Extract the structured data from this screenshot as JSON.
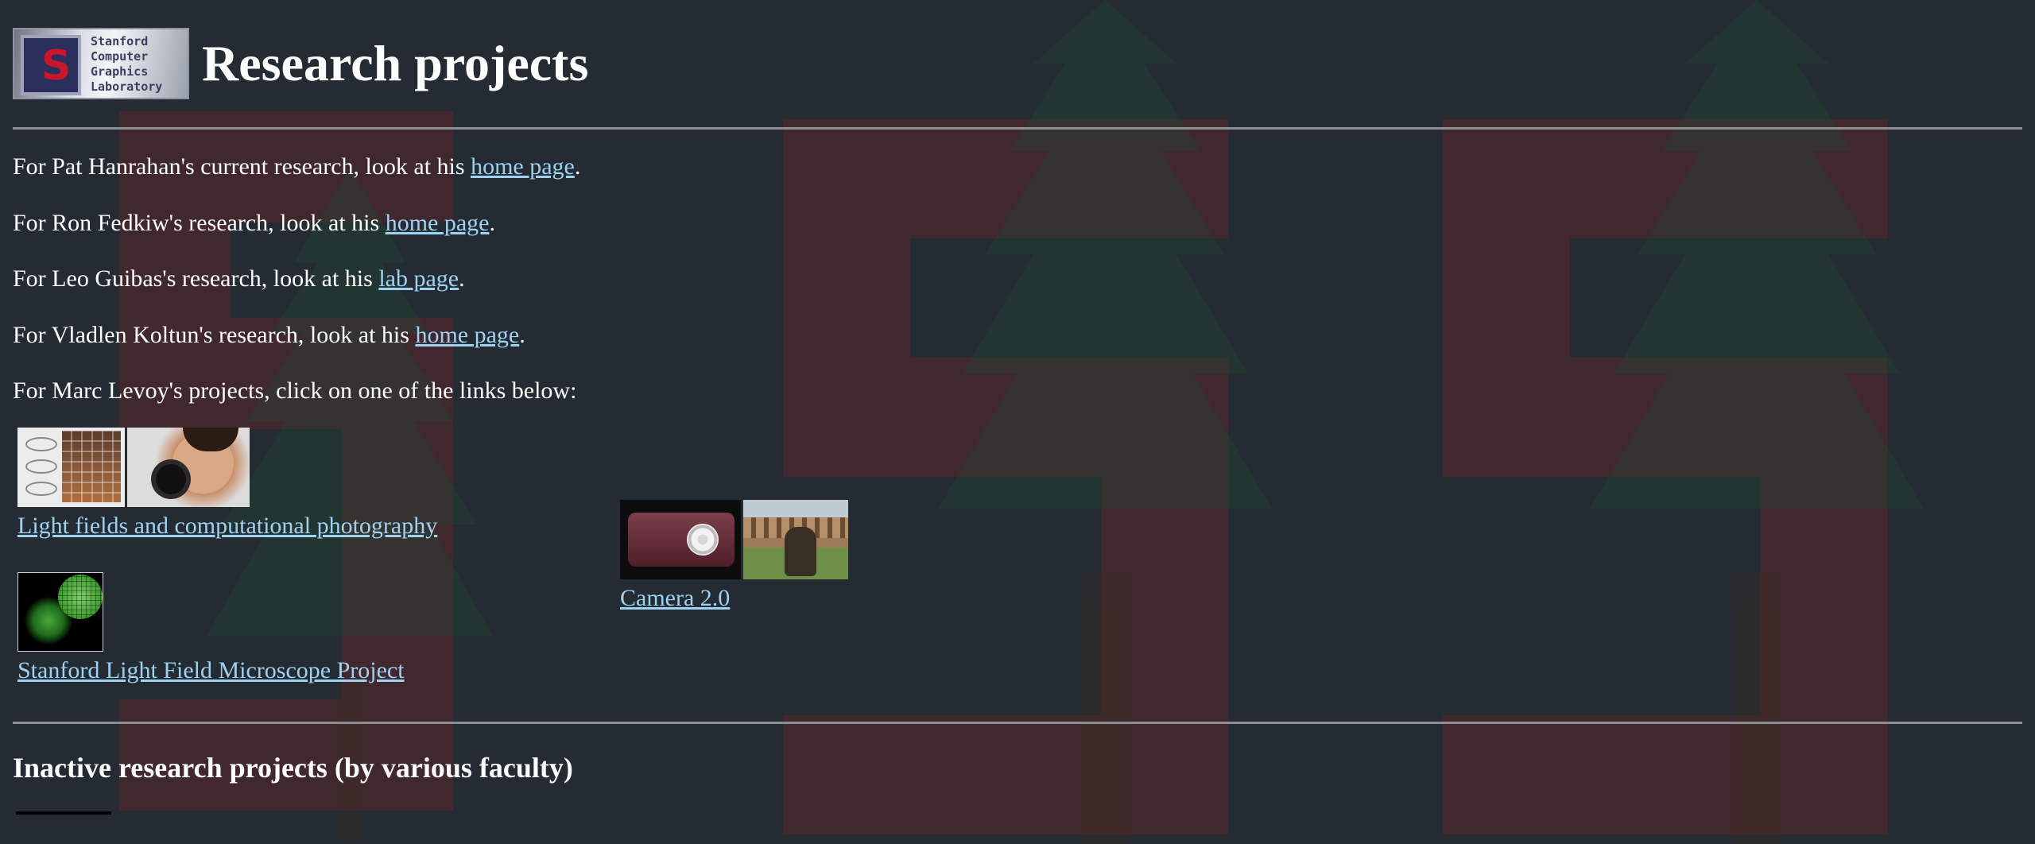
{
  "header": {
    "logo": {
      "letter": "S",
      "lines": [
        "Stanford",
        "Computer",
        "Graphics",
        "Laboratory"
      ]
    },
    "title": "Research projects"
  },
  "faculty": [
    {
      "before": "For Pat Hanrahan's current research, look at his ",
      "link": "home page",
      "after": "."
    },
    {
      "before": "For Ron Fedkiw's research, look at his ",
      "link": "home page",
      "after": "."
    },
    {
      "before": "For Leo Guibas's research, look at his ",
      "link": "lab page",
      "after": "."
    },
    {
      "before": "For Vladlen Koltun's research, look at his ",
      "link": "home page",
      "after": "."
    }
  ],
  "levoy_intro": "For Marc Levoy's projects, click on one of the links below:",
  "projects": [
    {
      "title": "Light fields and computational photography"
    },
    {
      "title": "Stanford Light Field Microscope Project"
    },
    {
      "title": "Camera 2.0"
    }
  ],
  "inactive": {
    "heading": "Inactive research projects (by various faculty)"
  },
  "colors": {
    "background": "#242b32",
    "link": "#9fd2f2",
    "rule": "#8b8f94"
  }
}
